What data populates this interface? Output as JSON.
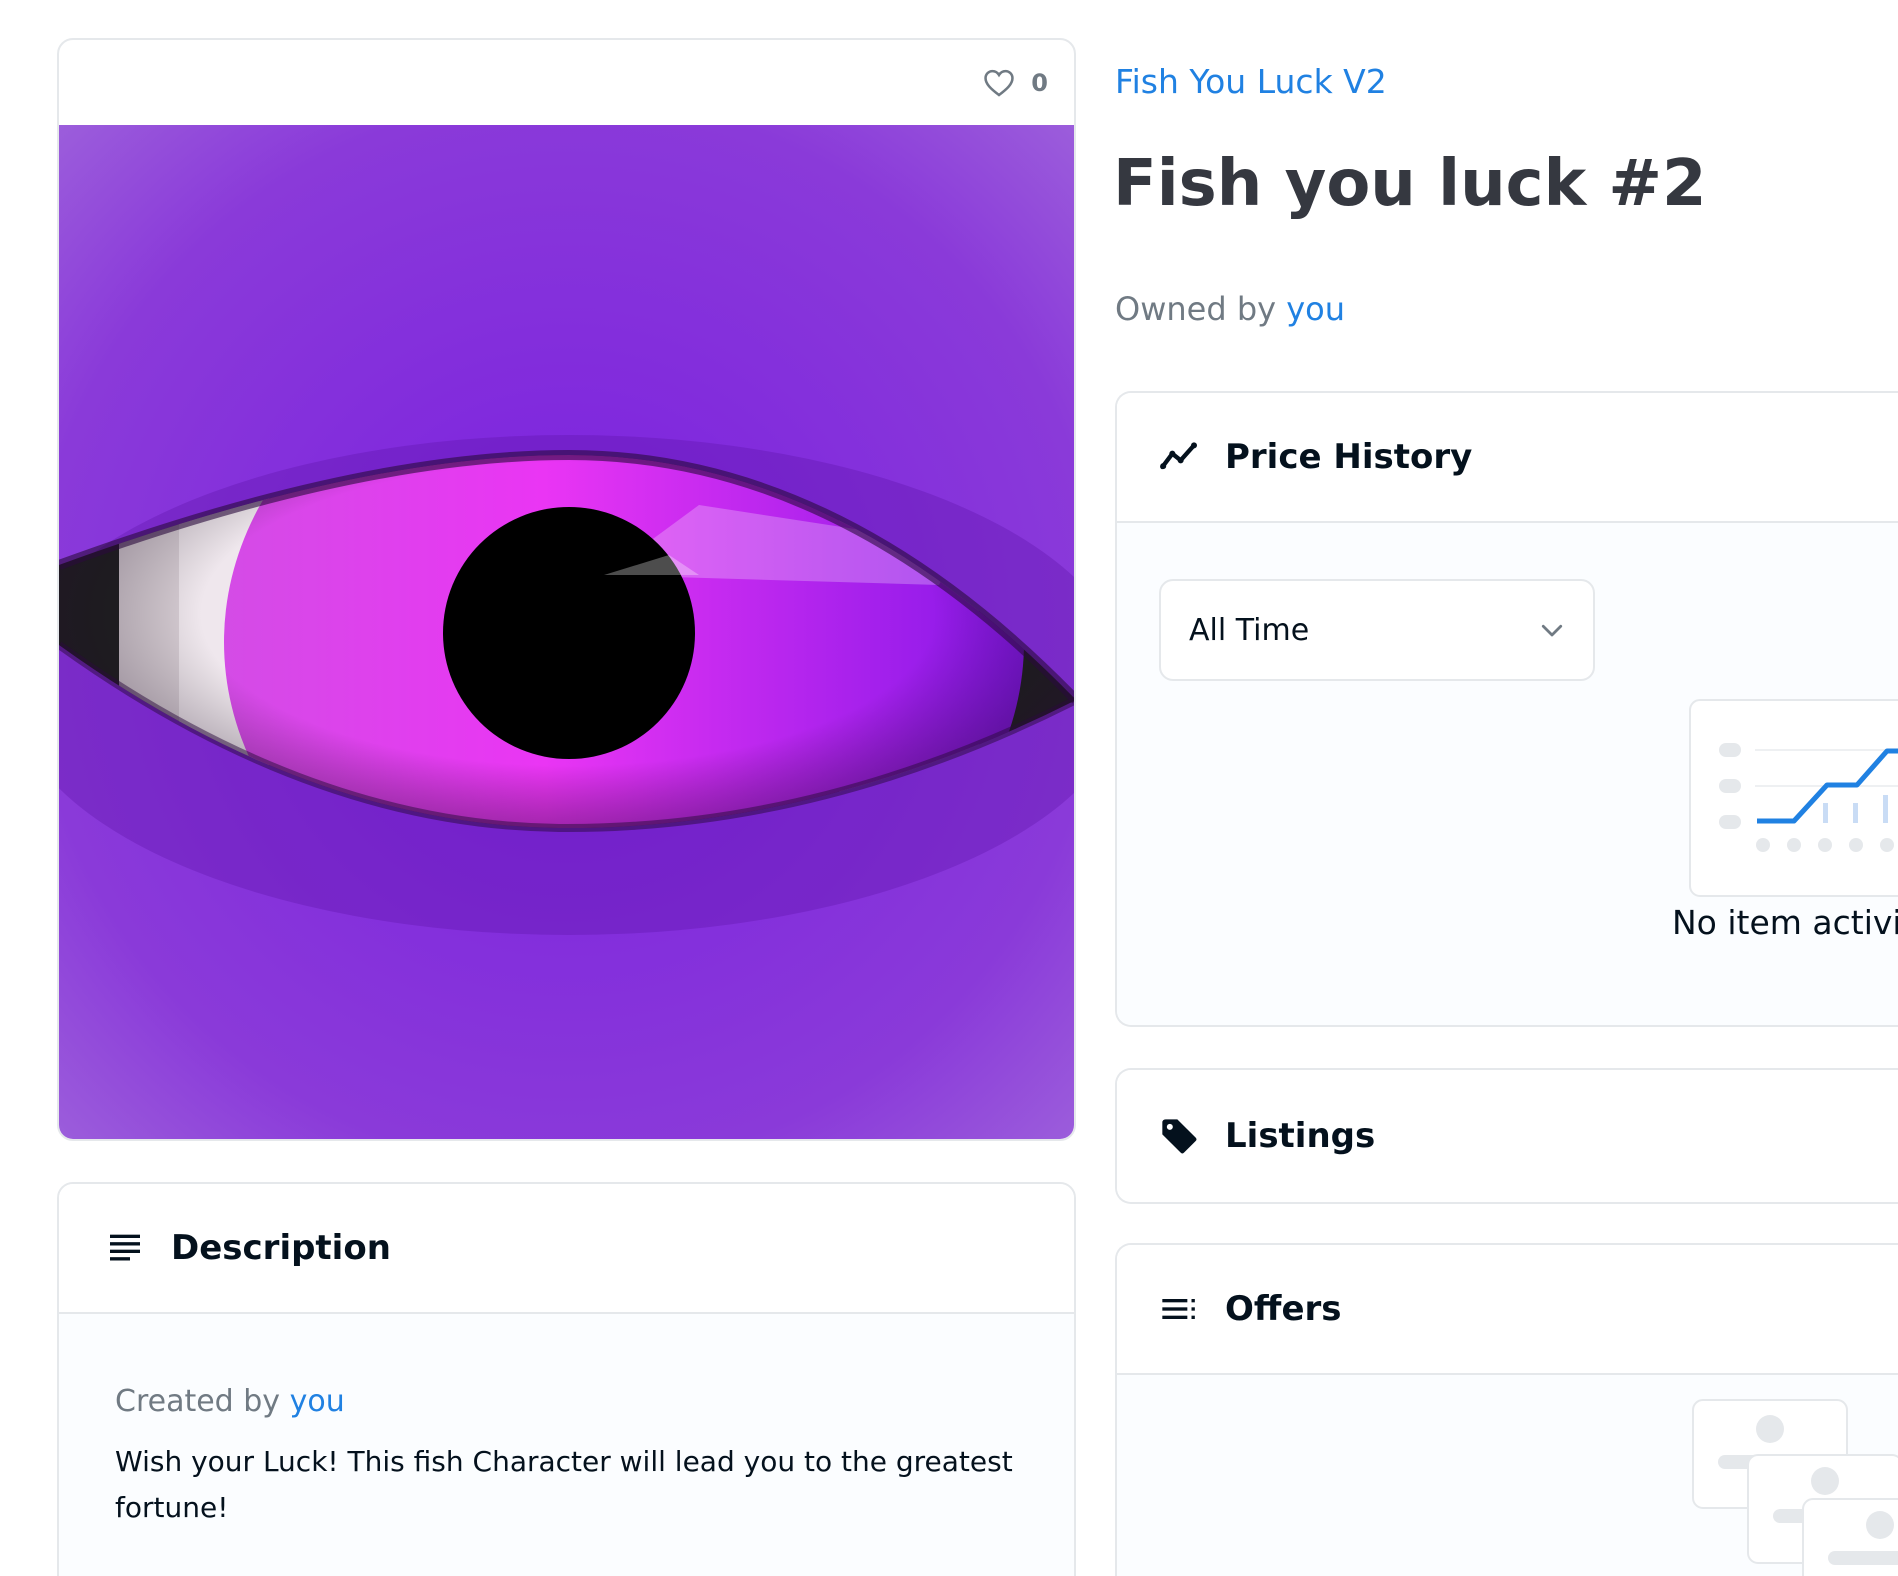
{
  "asset": {
    "favorite_count": "0",
    "collection_name": "Fish You Luck V2",
    "title": "Fish you luck #2",
    "owner_prefix": "Owned by",
    "owner": "you"
  },
  "description": {
    "heading": "Description",
    "created_prefix": "Created by",
    "creator": "you",
    "text": "Wish your Luck! This fish Character will lead you to the greatest fortune!"
  },
  "price_history": {
    "heading": "Price History",
    "filter_value": "All Time",
    "empty_text": "No item activit"
  },
  "listings": {
    "heading": "Listings"
  },
  "offers": {
    "heading": "Offers"
  },
  "colors": {
    "link": "#2081e2",
    "artwork_background": "#8a33de",
    "iris": "#e33cf7",
    "border": "#e5e8eb"
  },
  "icons": {
    "favorite": "heart-icon",
    "description": "text-lines-icon",
    "price_history": "trend-line-icon",
    "listings": "tag-icon",
    "offers": "list-icon",
    "filter": "chevron-down-icon"
  }
}
